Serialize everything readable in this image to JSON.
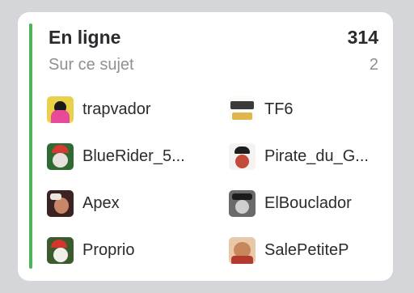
{
  "panel": {
    "title": "En ligne",
    "count": "314",
    "subtitle": "Sur ce sujet",
    "subcount": "2",
    "accent_color": "#4fb35c"
  },
  "users": [
    {
      "name": "trapvador",
      "avatar_icon": "user-avatar"
    },
    {
      "name": "TF6",
      "avatar_icon": "user-avatar"
    },
    {
      "name": "BlueRider_5...",
      "avatar_icon": "user-avatar"
    },
    {
      "name": "Pirate_du_G...",
      "avatar_icon": "user-avatar"
    },
    {
      "name": "Apex",
      "avatar_icon": "user-avatar"
    },
    {
      "name": "ElBouclador",
      "avatar_icon": "user-avatar"
    },
    {
      "name": "Proprio",
      "avatar_icon": "user-avatar"
    },
    {
      "name": "SalePetiteP",
      "avatar_icon": "user-avatar"
    }
  ]
}
